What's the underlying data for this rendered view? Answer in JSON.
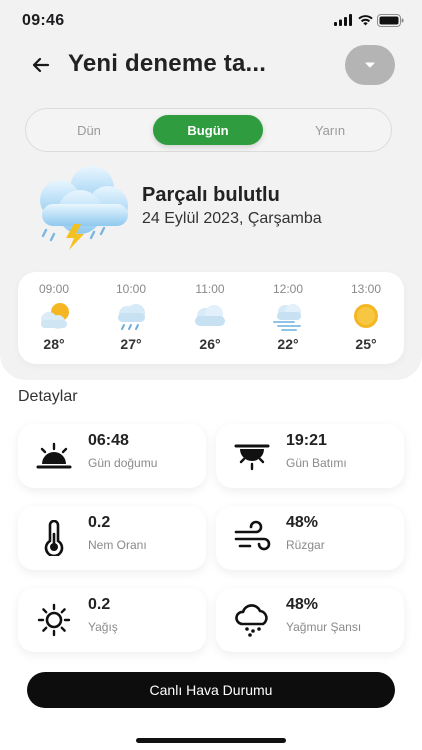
{
  "status_bar": {
    "time": "09:46"
  },
  "header": {
    "title": "Yeni deneme ta..."
  },
  "day_tabs": [
    {
      "label": "Dün"
    },
    {
      "label": "Bugün"
    },
    {
      "label": "Yarın"
    }
  ],
  "current": {
    "condition": "Parçalı bulutlu",
    "date": "24 Eylül 2023, Çarşamba",
    "icon": "cloud-storm-icon"
  },
  "hourly": [
    {
      "time": "09:00",
      "temp": "28°",
      "icon": "partly-cloudy-icon"
    },
    {
      "time": "10:00",
      "temp": "27°",
      "icon": "cloud-rain-icon"
    },
    {
      "time": "11:00",
      "temp": "26°",
      "icon": "cloud-icon"
    },
    {
      "time": "12:00",
      "temp": "22°",
      "icon": "cloud-wind-icon"
    },
    {
      "time": "13:00",
      "temp": "25°",
      "icon": "sun-icon"
    }
  ],
  "details_title": "Detaylar",
  "details": [
    {
      "value": "06:48",
      "label": "Gün doğumu",
      "icon": "sunrise-icon"
    },
    {
      "value": "19:21",
      "label": "Gün Batımı",
      "icon": "sunset-icon"
    },
    {
      "value": "0.2",
      "label": "Nem Oranı",
      "icon": "thermometer-icon"
    },
    {
      "value": "48%",
      "label": "Rüzgar",
      "icon": "wind-icon"
    },
    {
      "value": "0.2",
      "label": "Yağış",
      "icon": "sun-outline-icon"
    },
    {
      "value": "48%",
      "label": "Yağmur Şansı",
      "icon": "rain-cloud-icon"
    }
  ],
  "live_button": "Canlı Hava Durumu",
  "colors": {
    "accent": "#2f9d3f",
    "button": "#0d0d0d",
    "panel": "#f2f2f2"
  }
}
